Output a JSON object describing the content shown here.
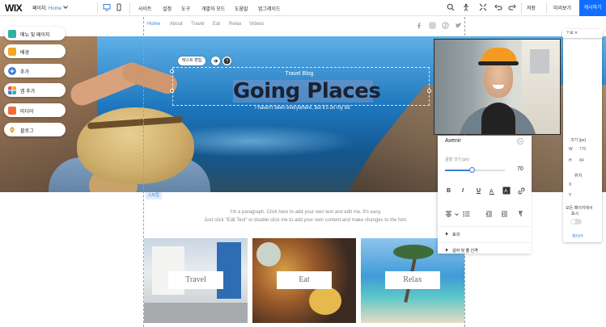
{
  "app": {
    "logo": "WIX"
  },
  "topbar": {
    "page_prefix": "페이지: ",
    "page_name": "Home",
    "menu": [
      "사이트",
      "설정",
      "도구",
      "개발자 모드",
      "도움말",
      "업그레이드"
    ],
    "save_label": "저장",
    "preview_label": "미리보기",
    "publish_label": "게시하기"
  },
  "site": {
    "nav": [
      "Home",
      "About",
      "Travel",
      "Eat",
      "Relax",
      "Videos"
    ],
    "hero": {
      "edit_chip": "텍스트 편집",
      "kicker": "Travel Blog",
      "title": "Going Places",
      "subtitle": "I haven't been everywhere, but it's on my list"
    },
    "strip_tag": "스트립",
    "paragraph_line1": "I'm a paragraph. Click here to add your own text and edit me. It's easy.",
    "paragraph_line2": "Just click \"Edit Text\" or double click me to add your own content and make changes to the font.",
    "tiles": [
      "Travel",
      "Eat",
      "Relax"
    ]
  },
  "left_panel": {
    "items": [
      {
        "label": "메뉴 및 페이지",
        "color": "#2bb3a3"
      },
      {
        "label": "배경",
        "color": "#f5a623"
      },
      {
        "label": "추가",
        "color": "#3b7dd8"
      },
      {
        "label": "앱 추가",
        "color": "#e8554e"
      },
      {
        "label": "미디어",
        "color": "#f26b3a"
      },
      {
        "label": "블로그",
        "color": "#e3a33a"
      }
    ]
  },
  "text_panel": {
    "font_name": "Avenir",
    "font_size_label": "글꼴 크기 (px)",
    "font_size_value": "70",
    "font_size_fraction": 0.45,
    "format_buttons": [
      "B",
      "I",
      "U"
    ],
    "section_effects": "효과",
    "section_spacing": "글자 및 줄 간격"
  },
  "size_panel": {
    "size_label": "크기 (px)",
    "w_label": "W",
    "w_value": "770",
    "h_label": "H",
    "h_value": "84",
    "position_label": "위치",
    "x_label": "X",
    "y_label": "Y",
    "hide_label_line1": "모든 페이지에서",
    "hide_label_line2": "표시",
    "layer_link": "레이어"
  },
  "mini_bar": "? ⊞ ✕",
  "colors": {
    "accent": "#116dff",
    "link": "#3b7dd8"
  }
}
